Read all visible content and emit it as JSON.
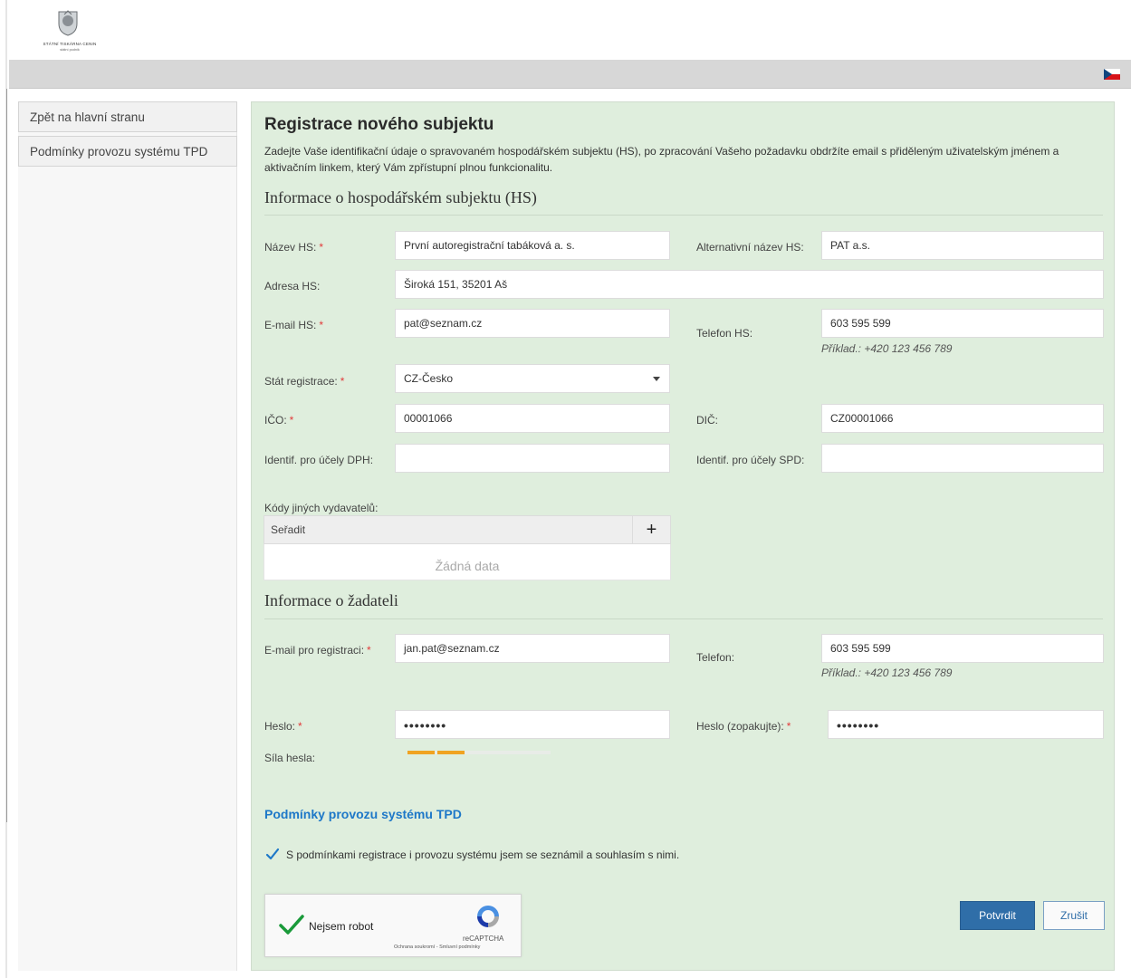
{
  "header": {
    "logo_text": "STÁTNÍ TISKÁRNA CENIN",
    "logo_subtext": "státní podnik",
    "language_flag": "czech-flag-icon"
  },
  "sidebar": {
    "items": [
      {
        "label": "Zpět na hlavní stranu"
      },
      {
        "label": "Podmínky provozu systému TPD"
      }
    ]
  },
  "form": {
    "title": "Registrace nového subjektu",
    "intro": "Zadejte Vaše identifikační údaje o spravovaném hospodářském subjektu (HS), po zpracování Vašeho požadavku obdržíte email s přiděleným uživatelským jménem a aktivačním linkem, který Vám zpřístupní plnou funkcionalitu.",
    "section_hs": "Informace o hospodářském subjektu (HS)",
    "fields_hs": {
      "nazev_label": "Název HS:",
      "nazev_value": "První autoregistrační tabáková a. s.",
      "alt_nazev_label": "Alternativní název HS:",
      "alt_nazev_value": "PAT a.s.",
      "adresa_label": "Adresa HS:",
      "adresa_value": "Široká 151, 35201 Aš",
      "email_label": "E-mail HS:",
      "email_value": "pat@seznam.cz",
      "telefon_label": "Telefon HS:",
      "telefon_value": "603 595 599",
      "telefon_hint": "Příklad.: +420 123 456 789",
      "stat_label": "Stát registrace:",
      "stat_value": "CZ-Česko",
      "ico_label": "IČO:",
      "ico_value": "00001066",
      "dic_label": "DIČ:",
      "dic_value": "CZ00001066",
      "dph_label": "Identif. pro účely DPH:",
      "dph_value": "",
      "spd_label": "Identif. pro účely SPD:",
      "spd_value": "",
      "kody_label": "Kódy jiných vydavatelů:",
      "kody_sort": "Seřadit",
      "kody_add": "+",
      "kody_empty": "Žádná data"
    },
    "section_zadatel": "Informace o žadateli",
    "fields_zadatel": {
      "email_label": "E-mail pro registraci:",
      "email_value": "jan.pat@seznam.cz",
      "telefon_label": "Telefon:",
      "telefon_value": "603 595 599",
      "telefon_hint": "Příklad.: +420 123 456 789",
      "heslo_label": "Heslo:",
      "heslo_value": "••••••••",
      "heslo2_label": "Heslo (zopakujte):",
      "heslo2_value": "••••••••",
      "sila_label": "Síla hesla:",
      "sila_level": 0.4
    },
    "required_mark": "*",
    "terms_link": "Podmínky provozu systému TPD",
    "agree_text": "S podmínkami registrace i provozu systému jsem se seznámil a souhlasím s nimi.",
    "agree_checked": true,
    "captcha": {
      "label": "Nejsem robot",
      "brand": "reCAPTCHA",
      "terms": "Ochrana soukromí - Smluvní podmínky"
    },
    "buttons": {
      "confirm": "Potvrdit",
      "cancel": "Zrušit"
    }
  },
  "colors": {
    "panel_bg": "#dfeedd",
    "primary": "#2f6ea8",
    "link": "#1e78c8",
    "strength": "#f0a322",
    "required": "#e23a3a"
  }
}
